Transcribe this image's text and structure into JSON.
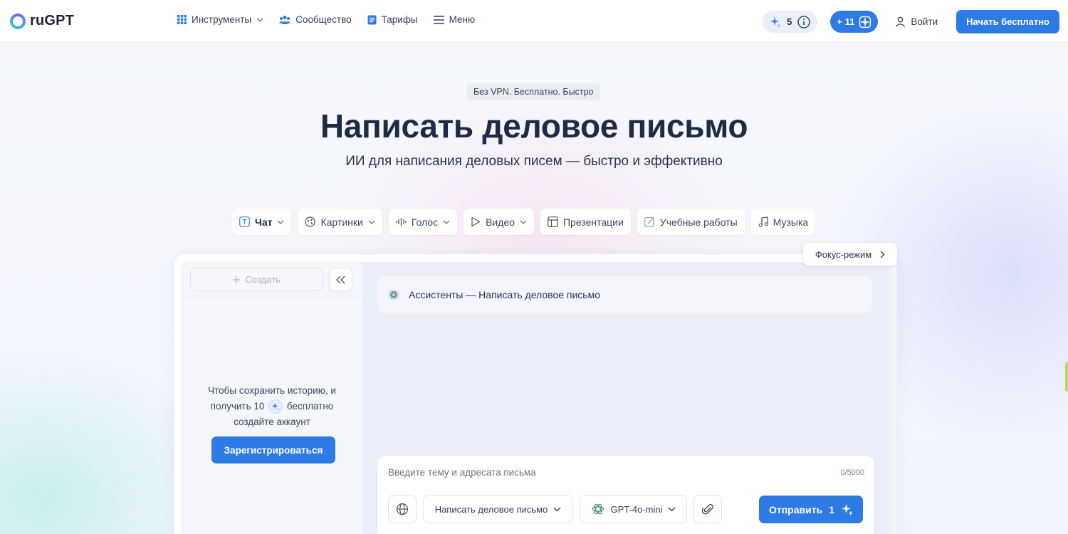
{
  "app": {
    "logo_text": "ruGPT"
  },
  "nav": {
    "items": [
      {
        "label": "Инструменты",
        "icon": "grid-icon",
        "dropdown": true
      },
      {
        "label": "Сообщество",
        "icon": "community-icon",
        "dropdown": false
      },
      {
        "label": "Тарифы",
        "icon": "document-icon",
        "dropdown": false
      },
      {
        "label": "Меню",
        "icon": "hamburger-icon",
        "dropdown": false
      }
    ]
  },
  "header": {
    "credits": "5",
    "bonus": "+ 11",
    "login_label": "Войти",
    "cta_label": "Начать бесплатно"
  },
  "hero": {
    "badge": "Без VPN. Бесплатно. Быстро",
    "title": "Написать деловое письмо",
    "subtitle": "ИИ для написания деловых писем — быстро и эффективно"
  },
  "modes": [
    {
      "label": "Чат",
      "icon": "text-icon",
      "dropdown": true,
      "active": true
    },
    {
      "label": "Картинки",
      "icon": "image-icon",
      "dropdown": true,
      "active": false
    },
    {
      "label": "Голос",
      "icon": "waveform-icon",
      "dropdown": true,
      "active": false
    },
    {
      "label": "Видео",
      "icon": "play-icon",
      "dropdown": true,
      "active": false
    },
    {
      "label": "Презентации",
      "icon": "layout-icon",
      "dropdown": false,
      "active": false
    },
    {
      "label": "Учебные работы",
      "icon": "edit-icon",
      "dropdown": false,
      "active": false
    },
    {
      "label": "Музыка",
      "icon": "music-icon",
      "dropdown": false,
      "active": false
    }
  ],
  "focus_mode": {
    "label": "Фокус-режим"
  },
  "sidebar": {
    "create_label": "Создать",
    "save_line1": "Чтобы сохранить историю, и",
    "save_line2_pre": "получить 10",
    "save_line2_post": "бесплатно",
    "save_line3": "создайте аккаунт",
    "register_label": "Зарегистрироваться"
  },
  "chat": {
    "assistant_title": "Ассистенты — Написать деловое письмо",
    "input_placeholder": "Введите тему и адресата письма",
    "counter": "0/5000",
    "template_select": "Написать деловое письмо",
    "model_select": "GPT-4o-mini",
    "send_label": "Отправить",
    "send_cost": "1"
  },
  "colors": {
    "accent": "#2f7be5",
    "title": "#1d2b45",
    "chat_bg": "#e8edf7"
  }
}
